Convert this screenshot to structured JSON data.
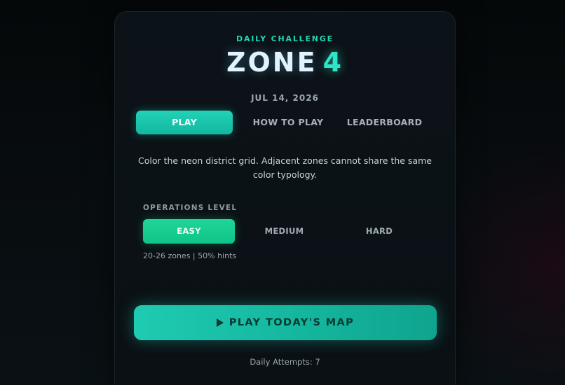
{
  "header": {
    "eyebrow": "DAILY CHALLENGE",
    "title_word": "ZONE",
    "title_number": "4",
    "date": "JUL 14, 2026"
  },
  "tabs": [
    {
      "label": "PLAY",
      "active": true
    },
    {
      "label": "HOW TO PLAY",
      "active": false
    },
    {
      "label": "LEADERBOARD",
      "active": false
    }
  ],
  "description": "Color the neon district grid. Adjacent zones cannot share the same color typology.",
  "operations": {
    "label": "OPERATIONS LEVEL",
    "levels": [
      {
        "label": "EASY",
        "selected": true
      },
      {
        "label": "MEDIUM",
        "selected": false
      },
      {
        "label": "HARD",
        "selected": false
      }
    ],
    "hint": "20-26 zones | 50% hints"
  },
  "cta": {
    "icon": "play-icon",
    "label": "PLAY TODAY'S MAP"
  },
  "footer": {
    "attempts_label": "Daily Attempts:",
    "attempts_count": "7"
  },
  "colors": {
    "accent": "#22d2b6",
    "easy_green": "#1fd598",
    "card_bg": "#0c1318"
  }
}
